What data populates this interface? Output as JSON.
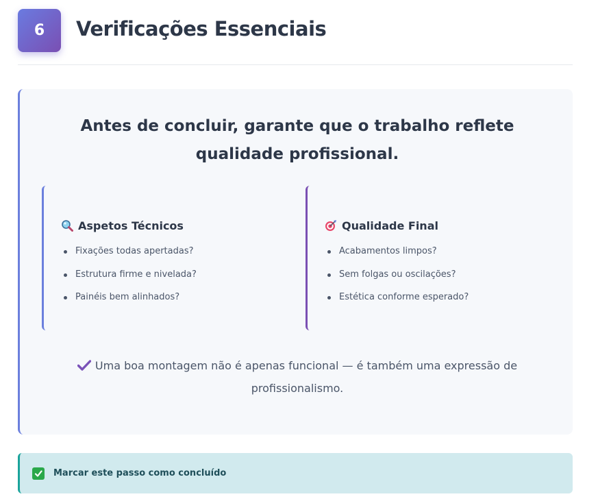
{
  "step": {
    "number": "6",
    "title": "Verificações Essenciais"
  },
  "card": {
    "intro": "Antes de concluir, garante que o trabalho reflete qualidade profissional.",
    "technical": {
      "icon": "magnifier-icon",
      "heading": "Aspetos Técnicos",
      "items": [
        "Fixações todas apertadas?",
        "Estrutura firme e nivelada?",
        "Painéis bem alinhados?"
      ]
    },
    "quality": {
      "icon": "target-icon",
      "heading": "Qualidade Final",
      "items": [
        "Acabamentos limpos?",
        "Sem folgas ou oscilações?",
        "Estética conforme esperado?"
      ]
    },
    "closing_icon": "heavy-check-mark-icon",
    "closing": "Uma boa montagem não é apenas funcional — é também uma expressão de profissionalismo."
  },
  "complete": {
    "checked": true,
    "label": "Marcar este passo como concluído"
  },
  "colors": {
    "accent_blue": "#6b7fdd",
    "accent_purple": "#7a4fb3",
    "complete_bg": "#d1eaee",
    "complete_border": "#1aa39b",
    "checkbox_green": "#2aa84a"
  }
}
